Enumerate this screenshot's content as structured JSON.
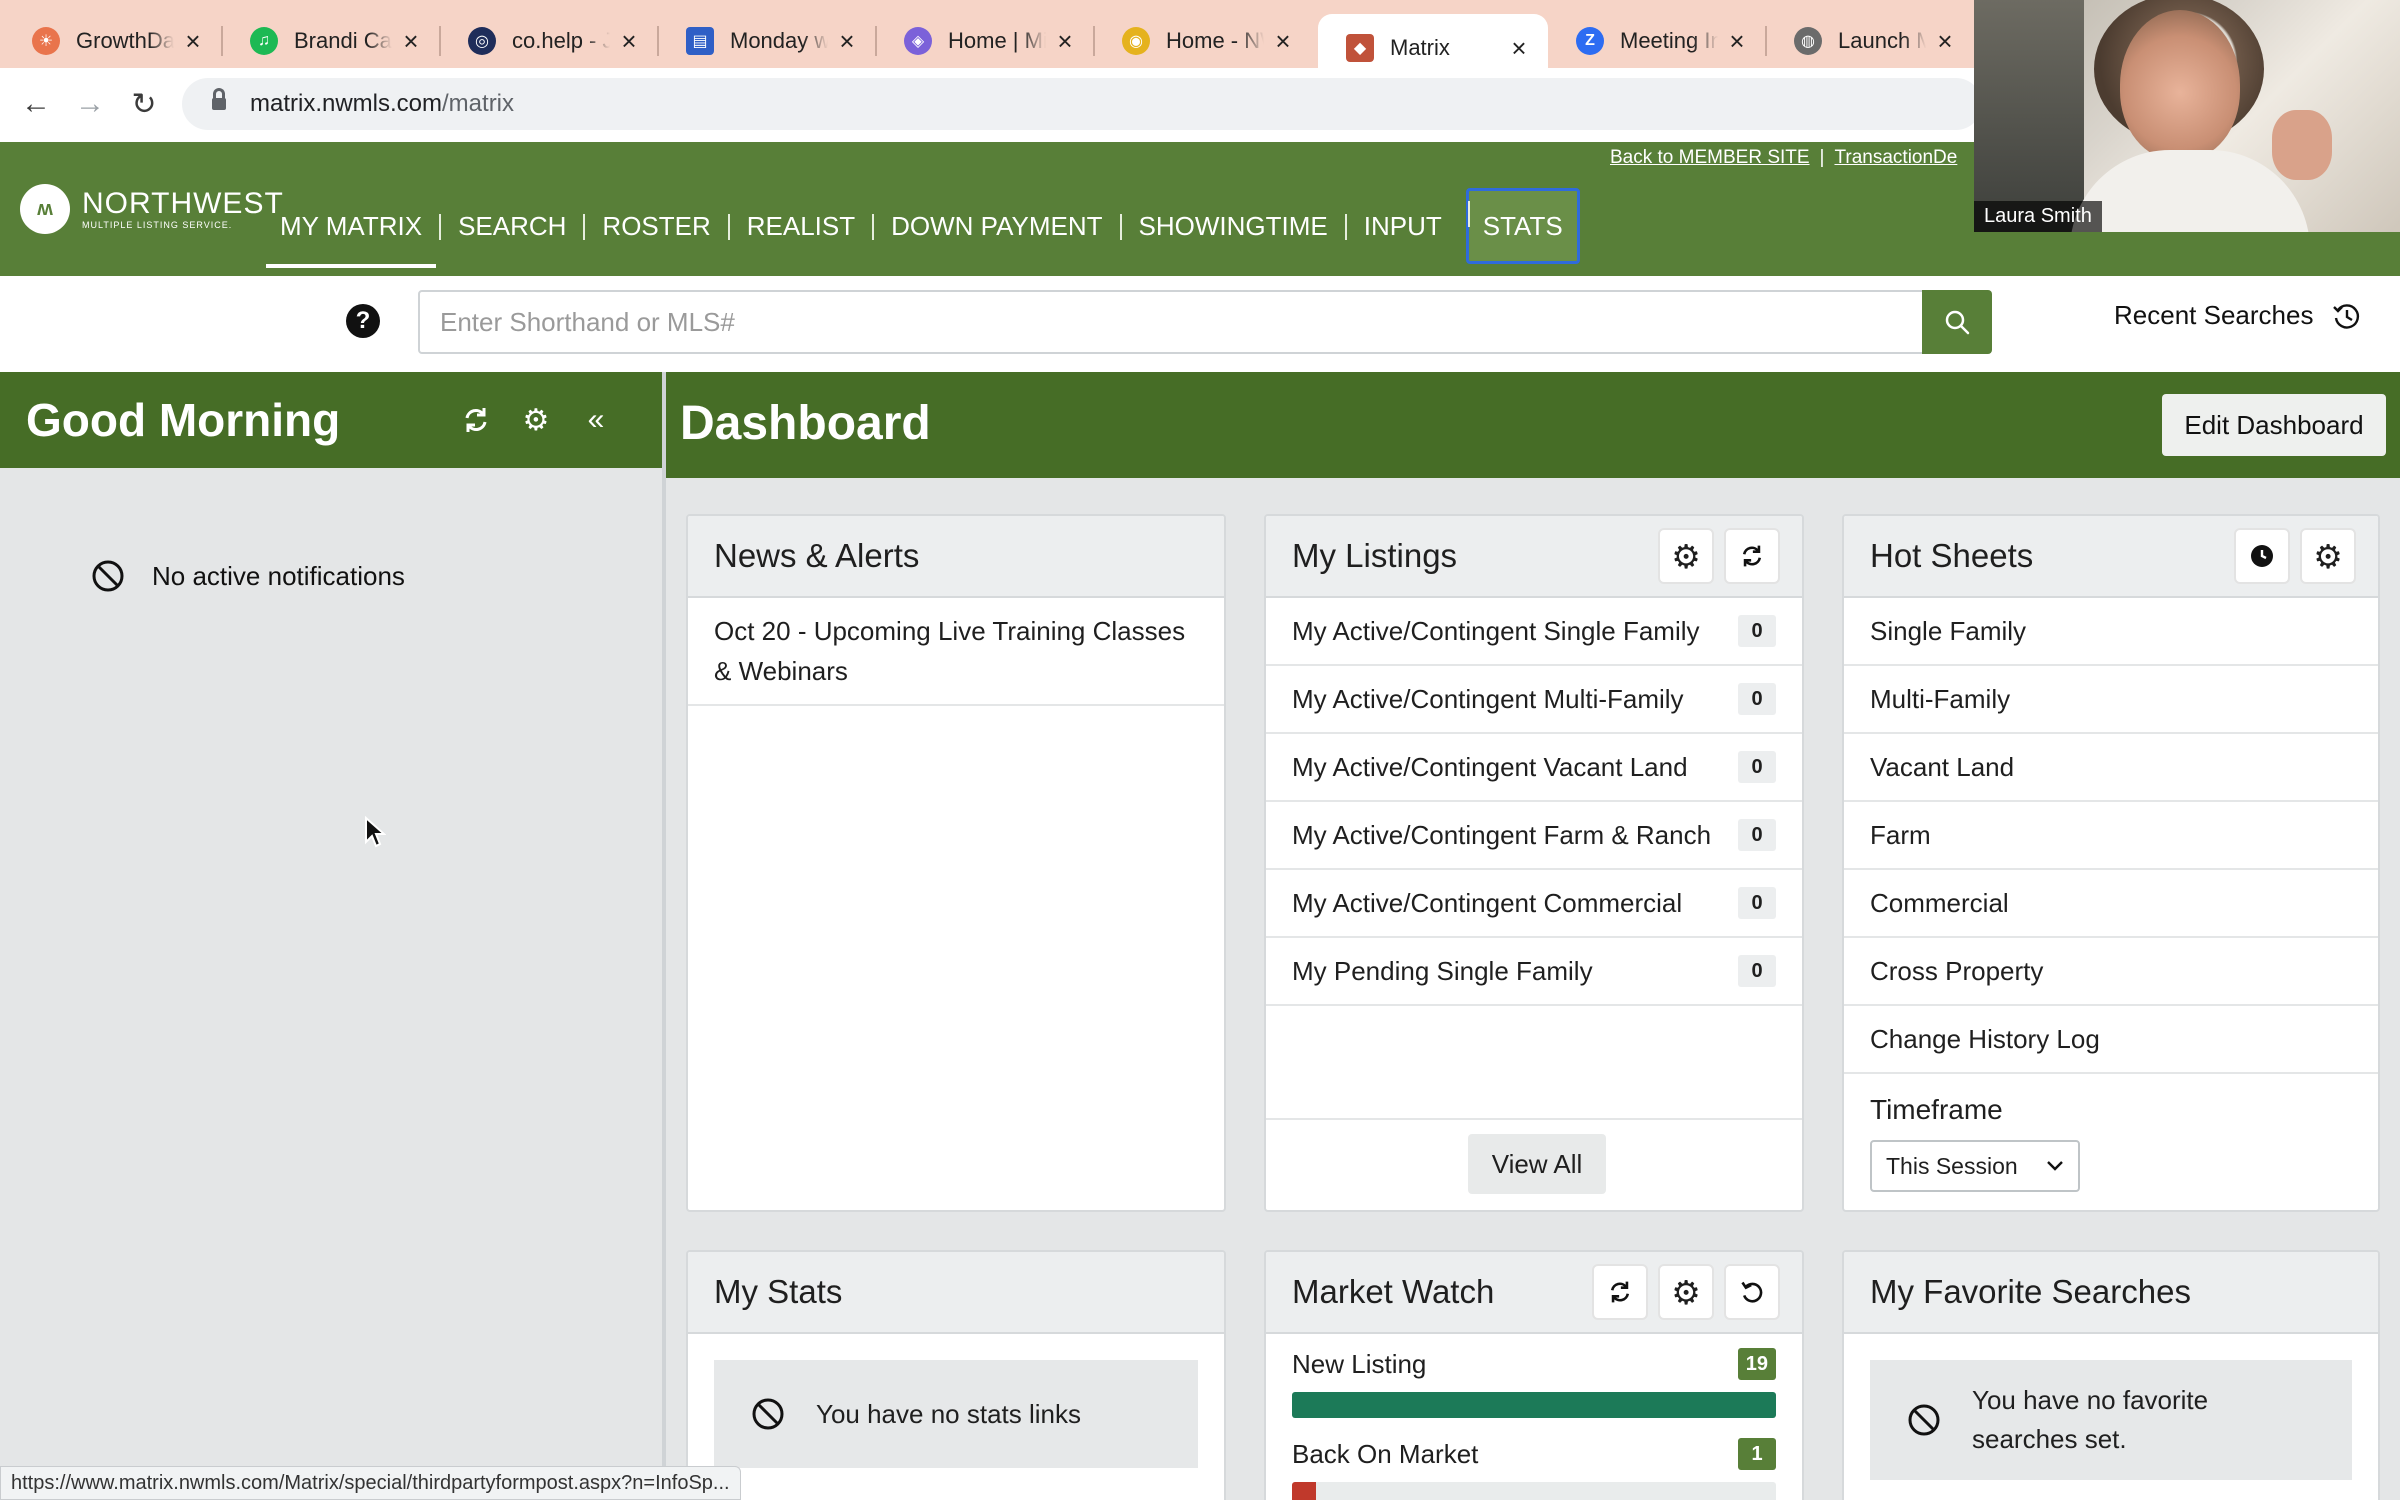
{
  "browser": {
    "tabs": [
      {
        "title": "GrowthDay",
        "color": "#e9744c",
        "glyph": "☀",
        "active": false
      },
      {
        "title": "Brandi Carli",
        "color": "#1db954",
        "glyph": "♫",
        "active": false
      },
      {
        "title": "co.help - Je",
        "color": "#1f2d5a",
        "glyph": "◎",
        "active": false
      },
      {
        "title": "Monday wit",
        "color": "#2f5fc6",
        "glyph": "▤",
        "active": false
      },
      {
        "title": "Home | Mic",
        "color": "#7b61d9",
        "glyph": "◈",
        "active": false
      },
      {
        "title": "Home - NW",
        "color": "#e5b21e",
        "glyph": "◉",
        "active": false
      },
      {
        "title": "Matrix",
        "color": "#c0523a",
        "glyph": "◆",
        "active": true
      },
      {
        "title": "Meeting Inf",
        "color": "#2d6cf2",
        "glyph": "Z",
        "active": false
      },
      {
        "title": "Launch Me",
        "color": "#6b6b6b",
        "glyph": "◍",
        "active": false
      }
    ],
    "url_host": "matrix.nwmls.com",
    "url_path": "/matrix",
    "status_url": "https://www.matrix.nwmls.com/Matrix/special/thirdpartyformpost.aspx?n=InfoSp..."
  },
  "video": {
    "participant_name": "Laura Smith"
  },
  "app": {
    "logo": {
      "line1": "NORTHWEST",
      "line2": "MULTIPLE LISTING SERVICE."
    },
    "menu": [
      "MY MATRIX",
      "SEARCH",
      "ROSTER",
      "REALIST",
      "DOWN PAYMENT",
      "SHOWINGTIME",
      "INPUT",
      "STATS"
    ],
    "top_links": {
      "back": "Back to MEMBER SITE",
      "transaction": "TransactionDe"
    }
  },
  "search": {
    "placeholder": "Enter Shorthand or MLS#",
    "value": "",
    "recent_label": "Recent Searches"
  },
  "left_panel": {
    "greeting": "Good Morning",
    "notification": "No active notifications"
  },
  "dashboard": {
    "title": "Dashboard",
    "edit_label": "Edit Dashboard",
    "news": {
      "title": "News & Alerts",
      "items": [
        "Oct 20 - Upcoming Live Training Classes & Webinars"
      ]
    },
    "my_listings": {
      "title": "My Listings",
      "items": [
        {
          "label": "My Active/Contingent Single Family",
          "count": "0"
        },
        {
          "label": "My Active/Contingent Multi-Family",
          "count": "0"
        },
        {
          "label": "My Active/Contingent Vacant Land",
          "count": "0"
        },
        {
          "label": "My Active/Contingent Farm & Ranch",
          "count": "0"
        },
        {
          "label": "My Active/Contingent Commercial",
          "count": "0"
        },
        {
          "label": "My Pending Single Family",
          "count": "0"
        }
      ],
      "view_all": "View All"
    },
    "hot_sheets": {
      "title": "Hot Sheets",
      "items": [
        "Single Family",
        "Multi-Family",
        "Vacant Land",
        "Farm",
        "Commercial",
        "Cross Property",
        "Change History Log"
      ],
      "timeframe_label": "Timeframe",
      "timeframe_value": "This Session"
    },
    "my_stats": {
      "title": "My Stats",
      "empty": "You have no stats links"
    },
    "market_watch": {
      "title": "Market Watch",
      "items": [
        {
          "label": "New Listing",
          "count": "19",
          "fill": 1.0,
          "color": "#1c7a58"
        },
        {
          "label": "Back On Market",
          "count": "1",
          "fill": 0.05,
          "color": "#c0392b"
        }
      ]
    },
    "favorite_searches": {
      "title": "My Favorite Searches",
      "empty_line1": "You have no favorite",
      "empty_line2": "searches set."
    }
  }
}
